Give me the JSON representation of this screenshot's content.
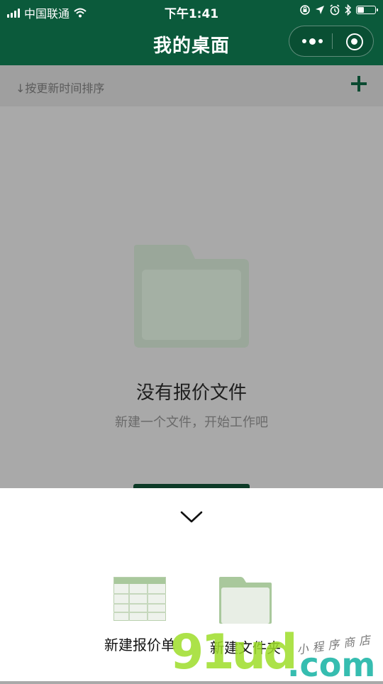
{
  "status_bar": {
    "carrier": "中国联通",
    "time": "下午1:41",
    "battery_level": 0.35,
    "icons": [
      "signal-icon",
      "wifi-icon",
      "orientation-lock-icon",
      "location-icon",
      "alarm-icon",
      "bluetooth-icon",
      "battery-icon"
    ]
  },
  "nav": {
    "title": "我的桌面",
    "capsule": [
      "more-icon",
      "close-target-icon"
    ]
  },
  "sort_bar": {
    "label": "↓按更新时间排序",
    "add_icon": "plus-icon"
  },
  "empty_state": {
    "icon": "folder-icon",
    "title": "没有报价文件",
    "subtitle": "新建一个文件，开始工作吧"
  },
  "sheet": {
    "collapse_icon": "chevron-down-icon",
    "options": [
      {
        "label": "新建报价单",
        "icon": "spreadsheet-icon"
      },
      {
        "label": "新建文件夹",
        "icon": "folder-icon"
      }
    ]
  },
  "watermark": {
    "brand": "91ud",
    "domain": ".com",
    "handwriting": "小程序商店"
  },
  "colors": {
    "primary": "#0b5a3b",
    "overlay": "#a9a9a9",
    "sheet": "#ffffff",
    "icon_green": "#a9c89c"
  }
}
